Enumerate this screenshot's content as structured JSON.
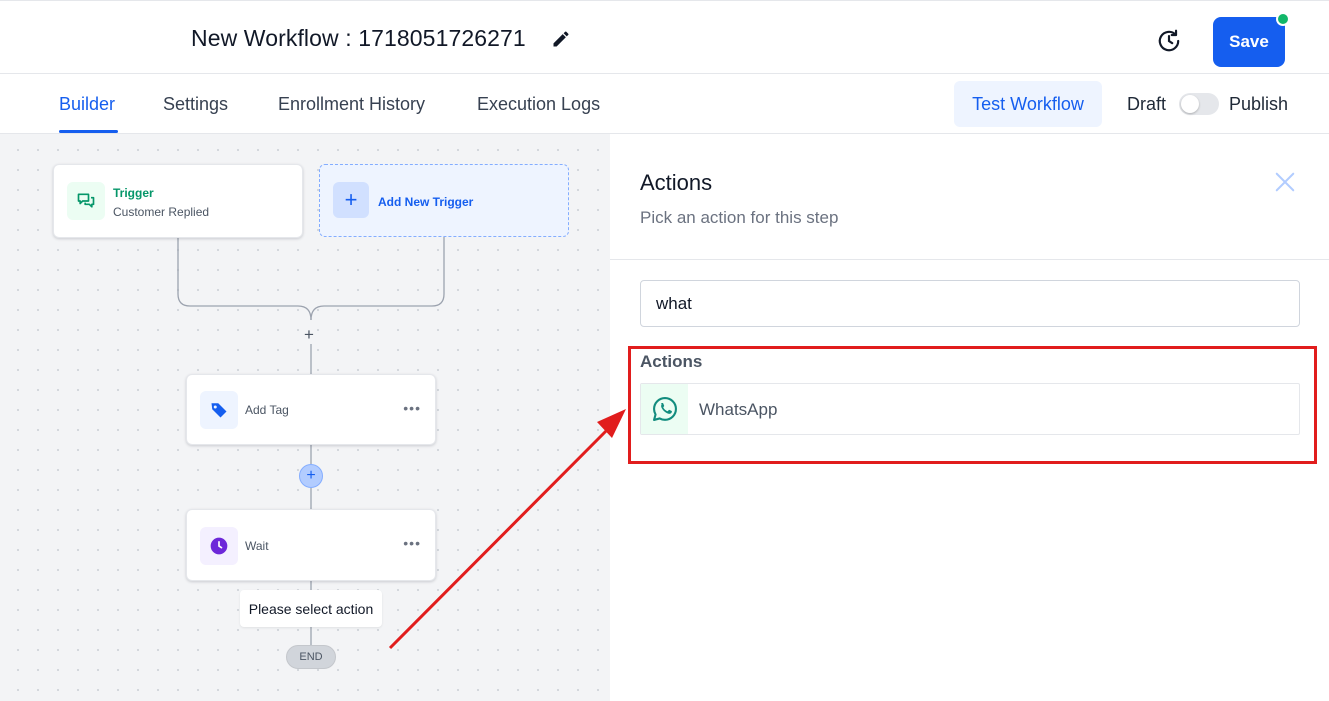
{
  "header": {
    "workflow_title": "New Workflow : 1718051726271",
    "save_label": "Save"
  },
  "tabs": [
    {
      "label": "Builder",
      "active": true
    },
    {
      "label": "Settings",
      "active": false
    },
    {
      "label": "Enrollment History",
      "active": false
    },
    {
      "label": "Execution Logs",
      "active": false
    }
  ],
  "toolbar": {
    "test_workflow_label": "Test Workflow",
    "draft_label": "Draft",
    "publish_label": "Publish",
    "published": false
  },
  "canvas": {
    "trigger": {
      "title": "Trigger",
      "subtitle": "Customer Replied",
      "icon": "chat-bubbles-icon"
    },
    "add_trigger_label": "Add New Trigger",
    "steps": [
      {
        "label": "Add Tag",
        "icon": "tag-icon",
        "icon_color": "#155eef"
      },
      {
        "label": "Wait",
        "icon": "clock-icon",
        "icon_color": "#6d28d9"
      }
    ],
    "tooltip": "Please select action",
    "end_label": "END"
  },
  "panel": {
    "title": "Actions",
    "subtitle": "Pick an action for this step",
    "search_value": "what",
    "section_label": "Actions",
    "results": [
      {
        "label": "WhatsApp",
        "icon": "whatsapp-icon",
        "icon_color": "#128c7e"
      }
    ]
  },
  "colors": {
    "accent": "#155eef",
    "success": "#12b76a",
    "annotation": "#e11d1d"
  }
}
